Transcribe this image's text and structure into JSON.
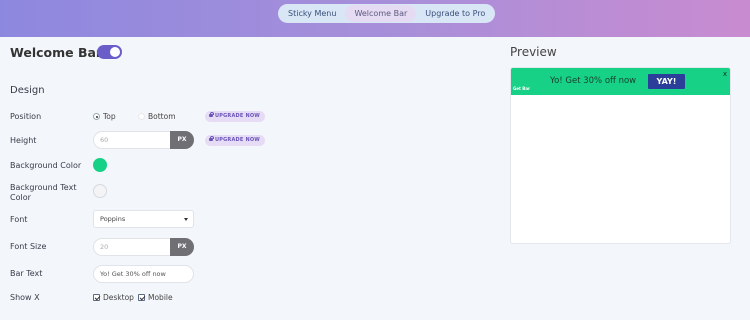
{
  "tabs": [
    {
      "label": "Sticky Menu"
    },
    {
      "label": "Welcome Bar"
    },
    {
      "label": "Upgrade to Pro"
    }
  ],
  "settings": {
    "title": "Welcome Bar",
    "enabled": true,
    "section": "Design",
    "position": {
      "label": "Position",
      "options": [
        "Top",
        "Bottom"
      ],
      "selected": "Top",
      "badge": "UPGRADE NOW"
    },
    "height": {
      "label": "Height",
      "value": "60",
      "unit": "PX",
      "badge": "UPGRADE NOW"
    },
    "background_color": {
      "label": "Background Color",
      "color": "#16d186"
    },
    "background_text_color": {
      "label": "Background Text Color",
      "color": "#f4f4f6"
    },
    "font": {
      "label": "Font",
      "value": "Poppins"
    },
    "font_size": {
      "label": "Font Size",
      "value": "20",
      "unit": "PX"
    },
    "bar_text": {
      "label": "Bar Text",
      "value": "Yo! Get 30% off now"
    },
    "show_x": {
      "label": "Show X",
      "options": [
        {
          "label": "Desktop",
          "checked": true
        },
        {
          "label": "Mobile",
          "checked": true
        }
      ]
    }
  },
  "preview": {
    "title": "Preview",
    "bar_text": "Yo! Get 30% off now",
    "button": "YAY!",
    "close": "x",
    "brand": "Get Bar"
  },
  "colors": {
    "accent": "#6b5dc8",
    "bar": "#16d186",
    "button": "#2a3e9a"
  }
}
